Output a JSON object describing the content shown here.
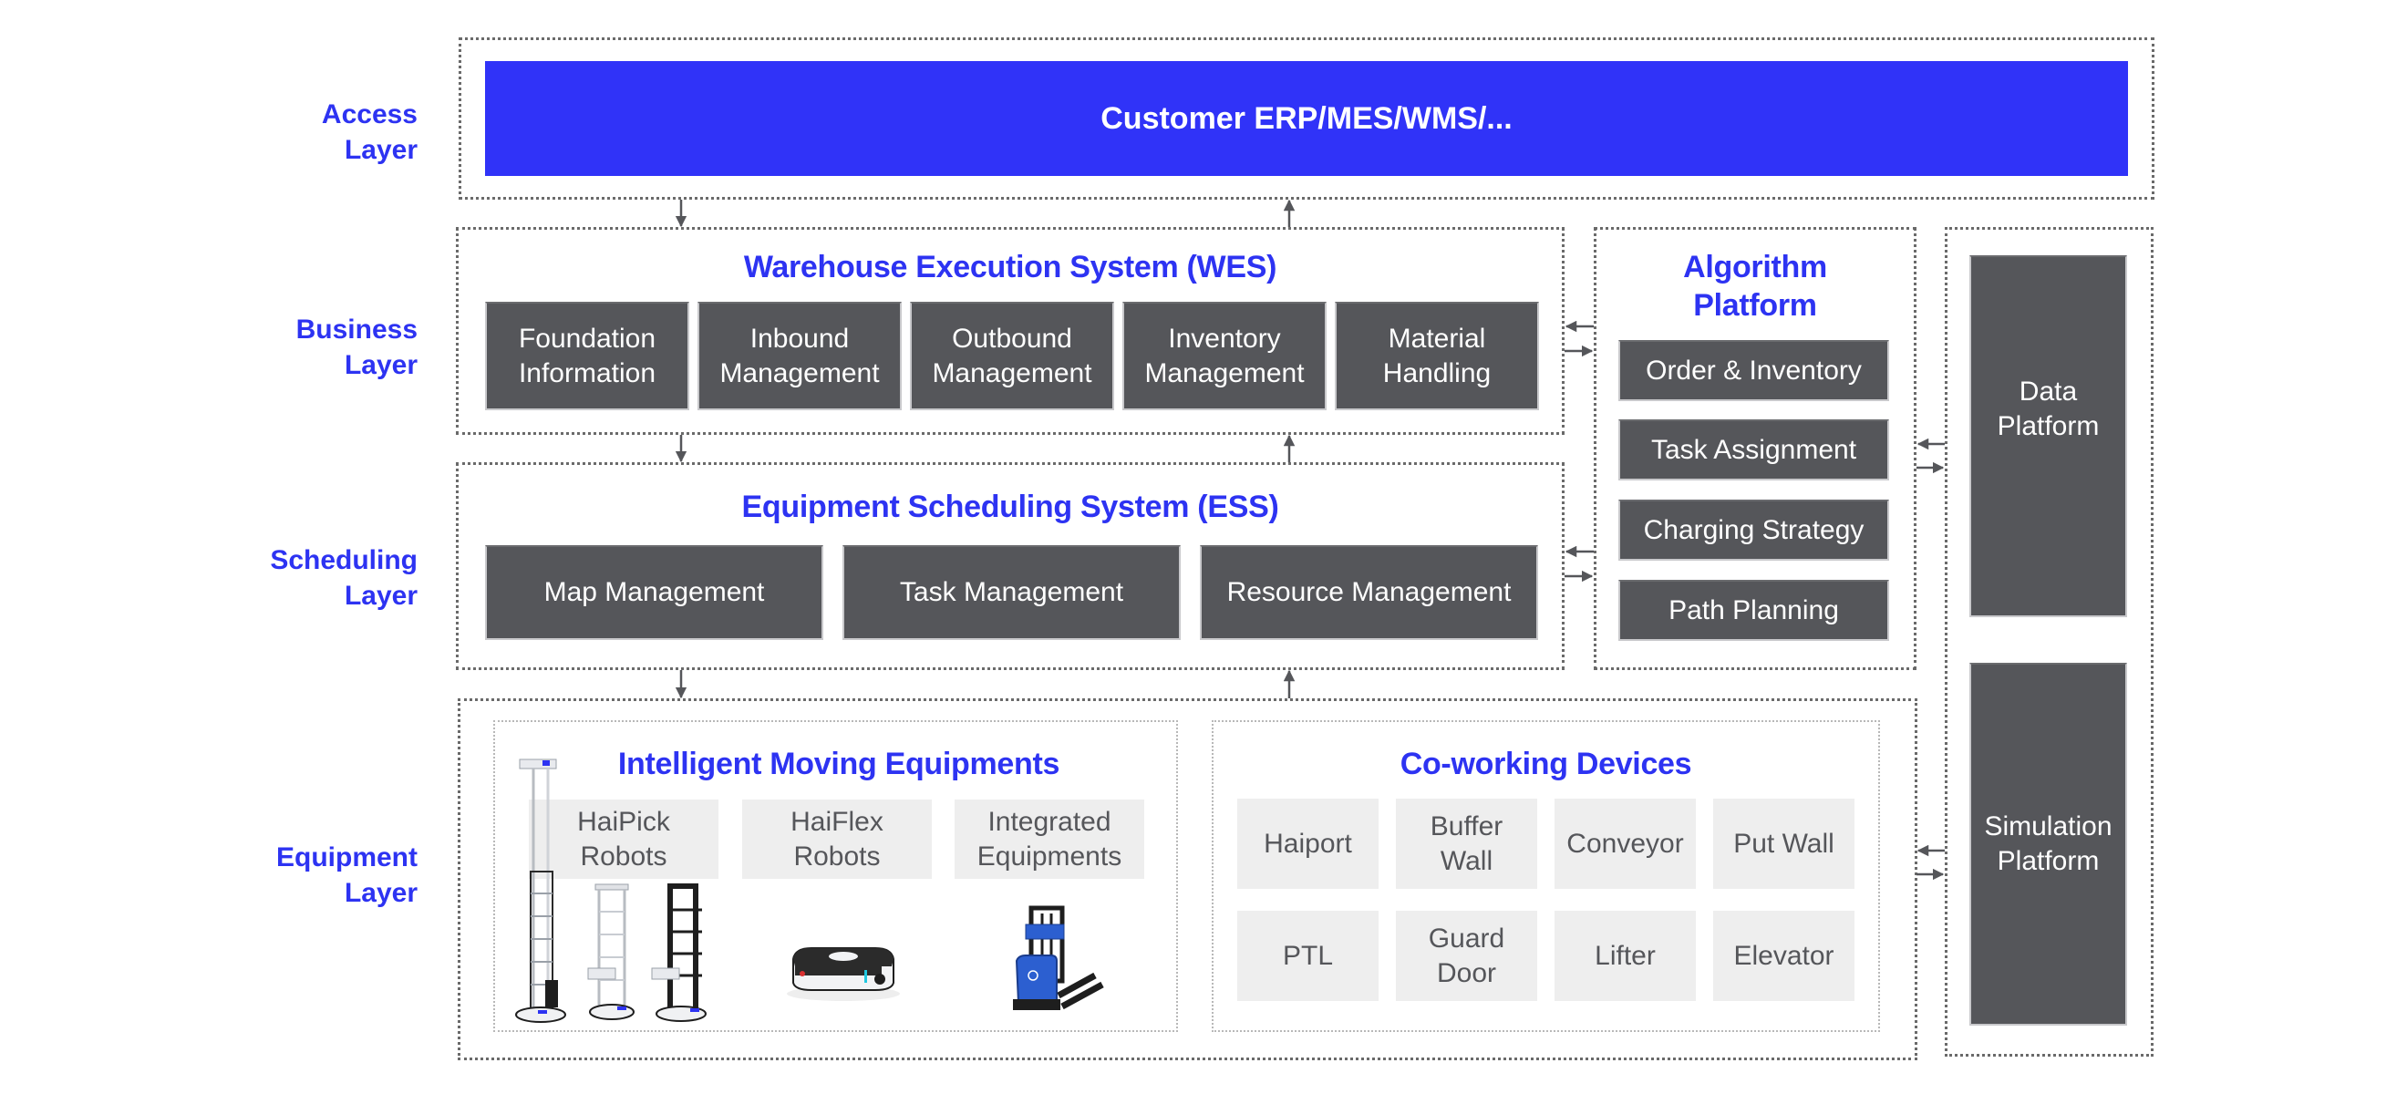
{
  "colors": {
    "accent_blue": "#2d33f2",
    "primary_fill": "#3033f8",
    "module_dark": "#55565a",
    "module_light": "#eeeeee",
    "border_gray": "#6a6a6a"
  },
  "layers": {
    "access": "Access\nLayer",
    "business": "Business\nLayer",
    "scheduling": "Scheduling\nLayer",
    "equipment": "Equipment\nLayer"
  },
  "access": {
    "customer_systems": "Customer ERP/MES/WMS/..."
  },
  "wes": {
    "title": "Warehouse Execution System (WES)",
    "modules": [
      "Foundation\nInformation",
      "Inbound\nManagement",
      "Outbound\nManagement",
      "Inventory\nManagement",
      "Material\nHandling"
    ]
  },
  "ess": {
    "title": "Equipment Scheduling System (ESS)",
    "modules": [
      "Map Management",
      "Task Management",
      "Resource Management"
    ]
  },
  "algorithm": {
    "title": "Algorithm\nPlatform",
    "modules": [
      "Order & Inventory",
      "Task Assignment",
      "Charging Strategy",
      "Path Planning"
    ]
  },
  "side_platforms": {
    "data": "Data\nPlatform",
    "simulation": "Simulation\nPlatform"
  },
  "moving_equipment": {
    "title": "Intelligent Moving Equipments",
    "items": [
      "HaiPick\nRobots",
      "HaiFlex\nRobots",
      "Integrated\nEquipments"
    ]
  },
  "coworking": {
    "title": "Co-working Devices",
    "items": [
      "Haiport",
      "Buffer\nWall",
      "Conveyor",
      "Put Wall",
      "PTL",
      "Guard\nDoor",
      "Lifter",
      "Elevator"
    ]
  },
  "icons": {
    "haipick_robot": "haipick-robot-illustration",
    "haiflex_robot": "haiflex-robot-illustration",
    "forklift": "forklift-illustration"
  }
}
